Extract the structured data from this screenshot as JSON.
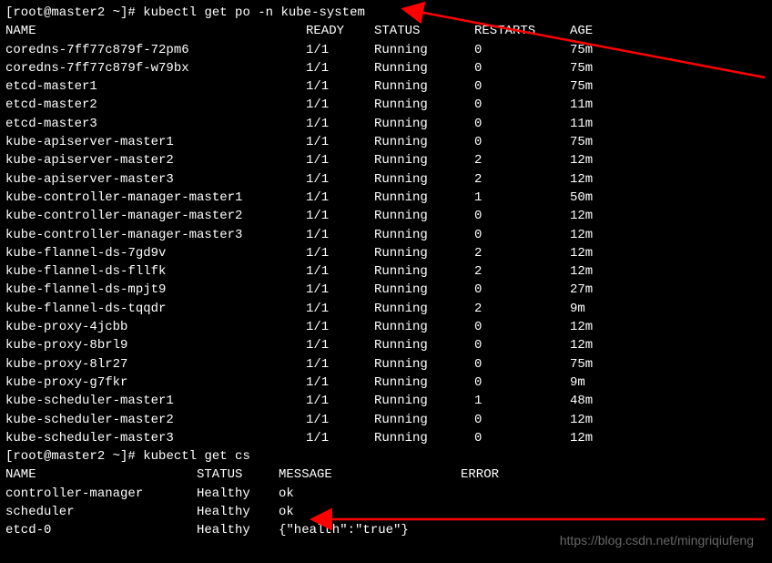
{
  "prompt1": {
    "user_host": "[root@master2 ~]#",
    "command": "kubectl get po -n kube-system"
  },
  "table1": {
    "headers": {
      "name": "NAME",
      "ready": "READY",
      "status": "STATUS",
      "restarts": "RESTARTS",
      "age": "AGE"
    },
    "rows": [
      {
        "name": "coredns-7ff77c879f-72pm6",
        "ready": "1/1",
        "status": "Running",
        "restarts": "0",
        "age": "75m"
      },
      {
        "name": "coredns-7ff77c879f-w79bx",
        "ready": "1/1",
        "status": "Running",
        "restarts": "0",
        "age": "75m"
      },
      {
        "name": "etcd-master1",
        "ready": "1/1",
        "status": "Running",
        "restarts": "0",
        "age": "75m"
      },
      {
        "name": "etcd-master2",
        "ready": "1/1",
        "status": "Running",
        "restarts": "0",
        "age": "11m"
      },
      {
        "name": "etcd-master3",
        "ready": "1/1",
        "status": "Running",
        "restarts": "0",
        "age": "11m"
      },
      {
        "name": "kube-apiserver-master1",
        "ready": "1/1",
        "status": "Running",
        "restarts": "0",
        "age": "75m"
      },
      {
        "name": "kube-apiserver-master2",
        "ready": "1/1",
        "status": "Running",
        "restarts": "2",
        "age": "12m"
      },
      {
        "name": "kube-apiserver-master3",
        "ready": "1/1",
        "status": "Running",
        "restarts": "2",
        "age": "12m"
      },
      {
        "name": "kube-controller-manager-master1",
        "ready": "1/1",
        "status": "Running",
        "restarts": "1",
        "age": "50m"
      },
      {
        "name": "kube-controller-manager-master2",
        "ready": "1/1",
        "status": "Running",
        "restarts": "0",
        "age": "12m"
      },
      {
        "name": "kube-controller-manager-master3",
        "ready": "1/1",
        "status": "Running",
        "restarts": "0",
        "age": "12m"
      },
      {
        "name": "kube-flannel-ds-7gd9v",
        "ready": "1/1",
        "status": "Running",
        "restarts": "2",
        "age": "12m"
      },
      {
        "name": "kube-flannel-ds-fllfk",
        "ready": "1/1",
        "status": "Running",
        "restarts": "2",
        "age": "12m"
      },
      {
        "name": "kube-flannel-ds-mpjt9",
        "ready": "1/1",
        "status": "Running",
        "restarts": "0",
        "age": "27m"
      },
      {
        "name": "kube-flannel-ds-tqqdr",
        "ready": "1/1",
        "status": "Running",
        "restarts": "2",
        "age": "9m"
      },
      {
        "name": "kube-proxy-4jcbb",
        "ready": "1/1",
        "status": "Running",
        "restarts": "0",
        "age": "12m"
      },
      {
        "name": "kube-proxy-8brl9",
        "ready": "1/1",
        "status": "Running",
        "restarts": "0",
        "age": "12m"
      },
      {
        "name": "kube-proxy-8lr27",
        "ready": "1/1",
        "status": "Running",
        "restarts": "0",
        "age": "75m"
      },
      {
        "name": "kube-proxy-g7fkr",
        "ready": "1/1",
        "status": "Running",
        "restarts": "0",
        "age": "9m"
      },
      {
        "name": "kube-scheduler-master1",
        "ready": "1/1",
        "status": "Running",
        "restarts": "1",
        "age": "48m"
      },
      {
        "name": "kube-scheduler-master2",
        "ready": "1/1",
        "status": "Running",
        "restarts": "0",
        "age": "12m"
      },
      {
        "name": "kube-scheduler-master3",
        "ready": "1/1",
        "status": "Running",
        "restarts": "0",
        "age": "12m"
      }
    ]
  },
  "prompt2": {
    "user_host": "[root@master2 ~]#",
    "command": "kubectl get cs"
  },
  "table2": {
    "headers": {
      "name": "NAME",
      "status": "STATUS",
      "message": "MESSAGE",
      "error": "ERROR"
    },
    "rows": [
      {
        "name": "controller-manager",
        "status": "Healthy",
        "message": "ok",
        "error": ""
      },
      {
        "name": "scheduler",
        "status": "Healthy",
        "message": "ok",
        "error": ""
      },
      {
        "name": "etcd-0",
        "status": "Healthy",
        "message": "{\"health\":\"true\"}",
        "error": ""
      }
    ]
  },
  "watermark": "https://blog.csdn.net/mingriqiufeng"
}
